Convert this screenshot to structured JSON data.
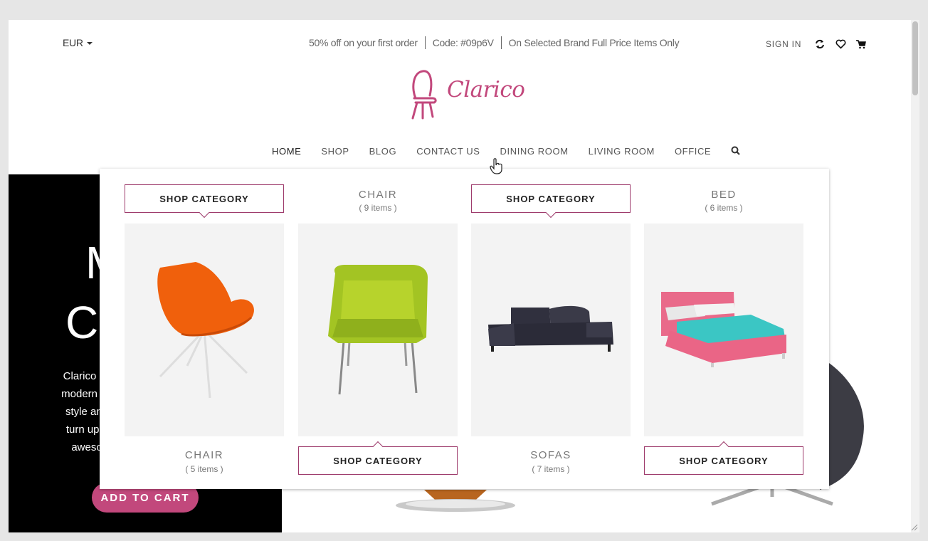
{
  "topbar": {
    "currency": "EUR",
    "promo": [
      "50% off on your first order",
      "Code: #09p6V",
      "On Selected Brand Full Price Items Only"
    ],
    "sign_in": "SIGN IN"
  },
  "logo": {
    "text": "Clarico"
  },
  "nav": {
    "items": [
      "HOME",
      "SHOP",
      "BLOG",
      "CONTACT US",
      "DINING ROOM",
      "LIVING ROOM",
      "OFFICE"
    ]
  },
  "hero": {
    "title_1": "M",
    "title_2": "Co",
    "desc_lines": [
      "Clarico ov",
      "modern de",
      "style and",
      "turn up y",
      "aweso"
    ],
    "add_to_cart": "ADD TO CART"
  },
  "mega_menu": {
    "shop_label": "SHOP CATEGORY",
    "columns": [
      {
        "name": "CHAIR",
        "count": "( 5 items )",
        "image": "orange-chair"
      },
      {
        "name": "CHAIR",
        "count": "( 9 items )",
        "image": "green-chair"
      },
      {
        "name": "SOFAS",
        "count": "( 7 items )",
        "image": "dark-sofa"
      },
      {
        "name": "BED",
        "count": "( 6 items )",
        "image": "pink-bed"
      }
    ]
  },
  "colors": {
    "brand": "#c2487c",
    "border": "#9e3b6c"
  }
}
